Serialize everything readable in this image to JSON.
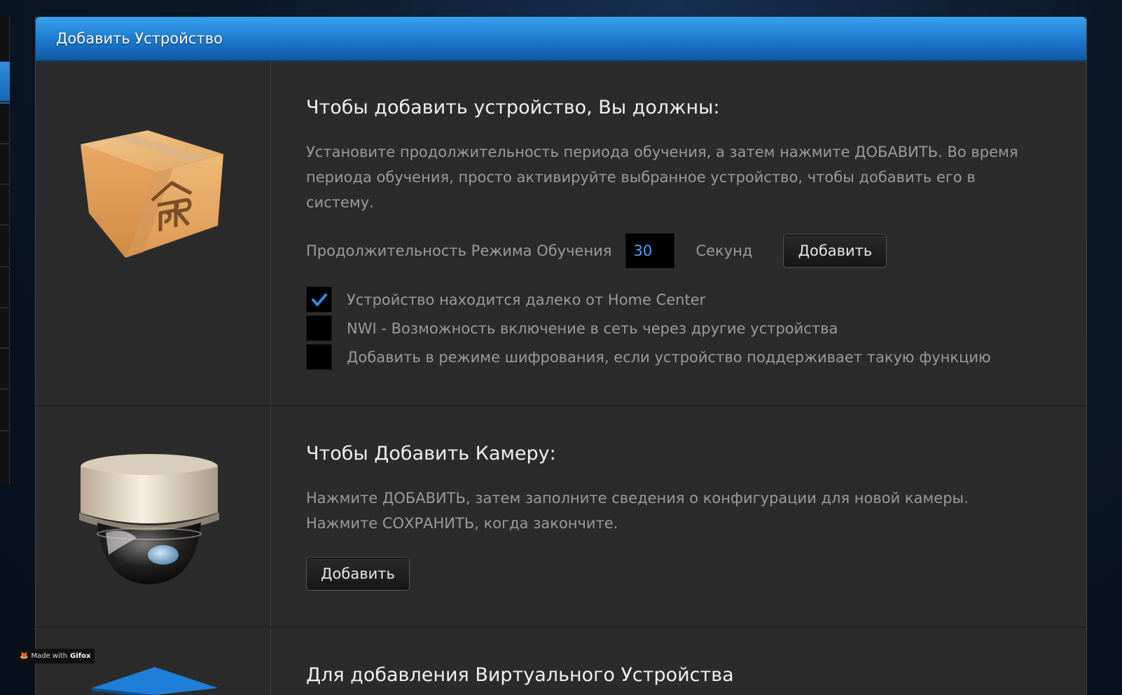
{
  "panel": {
    "title": "Добавить Устройство"
  },
  "device_section": {
    "heading": "Чтобы добавить устройство, Вы должны:",
    "description": "Установите продолжительность периода обучения, а затем нажмите ДОБАВИТЬ. Во время периода обучения, просто активируйте выбранное устройство, чтобы добавить его в систему.",
    "learn_label": "Продолжительность Режима Обучения",
    "learn_value": "30",
    "learn_unit": "Секунд",
    "add_label": "Добавить",
    "options": [
      {
        "label": "Устройство находится далеко от Home Center",
        "checked": true
      },
      {
        "label": "NWI - Возможность включение в сеть через другие устройства",
        "checked": false
      },
      {
        "label": "Добавить в режиме шифрования, если устройство поддерживает такую функцию",
        "checked": false
      }
    ]
  },
  "camera_section": {
    "heading": "Чтобы Добавить Камеру:",
    "description_line1": "Нажмите ДОБАВИТЬ, затем заполните сведения о конфигурации для новой камеры.",
    "description_line2": "Нажмите СОХРАНИТЬ, когда закончите.",
    "add_label": "Добавить"
  },
  "virtual_section": {
    "heading": "Для добавления Виртуального Устройства"
  },
  "watermark": {
    "prefix": "Made with",
    "brand": "Gifox"
  },
  "colors": {
    "header_blue": "#1c78cc",
    "accent_value": "#4aa3ff",
    "check_mark": "#2e8ae6",
    "panel_bg": "#2b2b2b"
  }
}
